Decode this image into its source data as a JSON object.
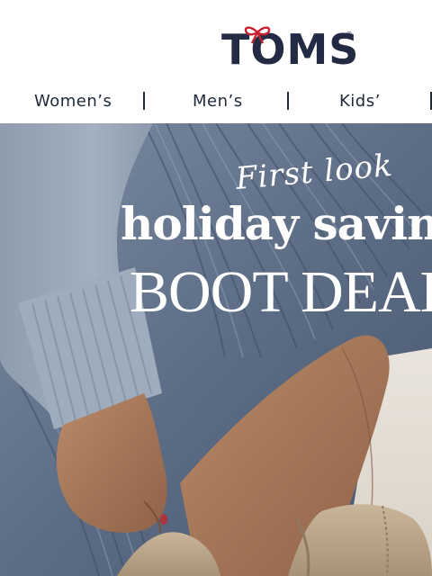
{
  "header": {
    "logo": {
      "text": "TOMS",
      "registered_mark": "®",
      "bow_icon": "ribbon-bow-icon"
    }
  },
  "nav": {
    "items": [
      {
        "label": "Women’s"
      },
      {
        "label": "Men’s"
      },
      {
        "label": "Kids’"
      }
    ]
  },
  "hero": {
    "eyebrow": "First look",
    "headline": "holiday saving",
    "subheadline": "BOOT DEALS"
  },
  "colors": {
    "brand_navy": "#222a44",
    "bow_red": "#c8202f",
    "nav_text": "#1f2a3a",
    "hero_text": "#ffffff"
  }
}
